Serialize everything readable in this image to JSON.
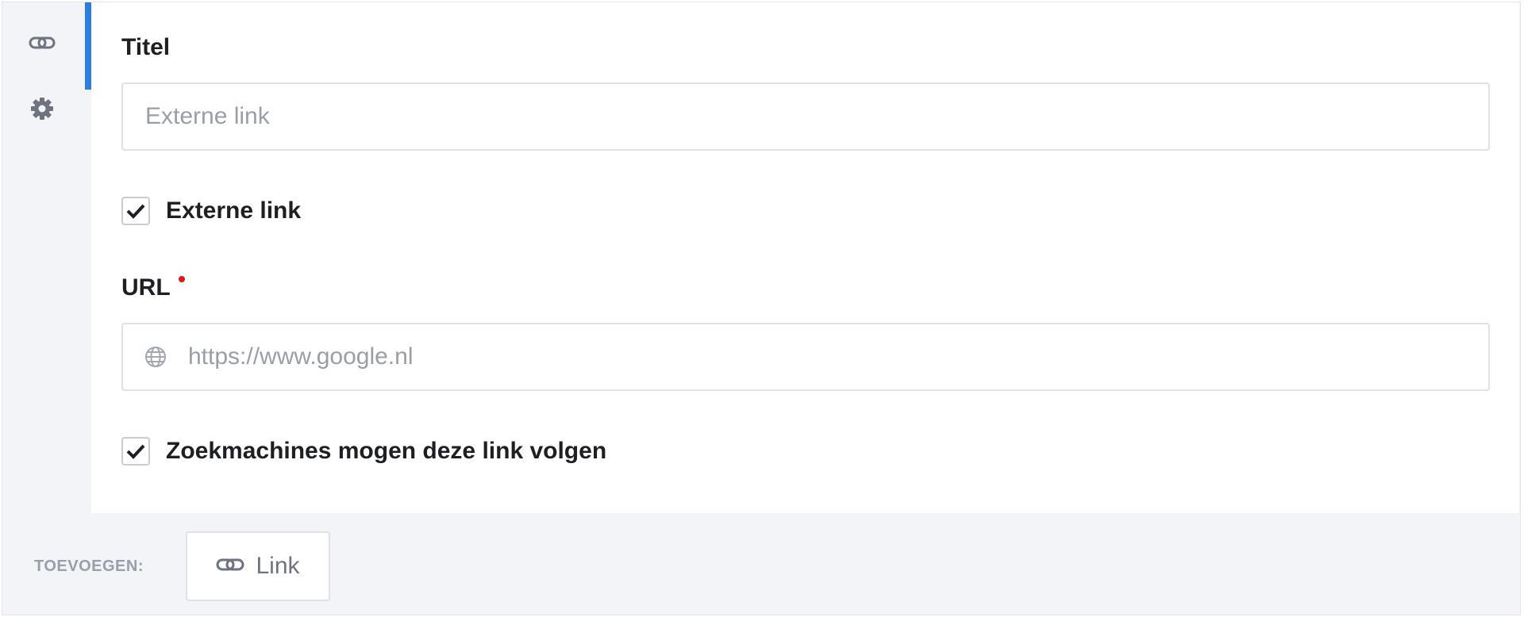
{
  "sidebar": {
    "tabs": [
      {
        "icon": "link-icon",
        "active": true
      },
      {
        "icon": "gear-icon",
        "active": false
      }
    ]
  },
  "form": {
    "title": {
      "label": "Titel",
      "value": "",
      "placeholder": "Externe link"
    },
    "external_checkbox": {
      "label": "Externe link",
      "checked": true
    },
    "url": {
      "label": "URL",
      "required": true,
      "value": "",
      "placeholder": "https://www.google.nl",
      "icon": "globe-icon"
    },
    "follow_checkbox": {
      "label": "Zoekmachines mogen deze link volgen",
      "checked": true
    }
  },
  "add_bar": {
    "label": "TOEVOEGEN:",
    "button_label": "Link",
    "button_icon": "link-icon"
  },
  "colors": {
    "accent": "#2b7de0",
    "required": "#e0181c",
    "background": "#f3f4f8",
    "border": "#dfe1e6"
  }
}
